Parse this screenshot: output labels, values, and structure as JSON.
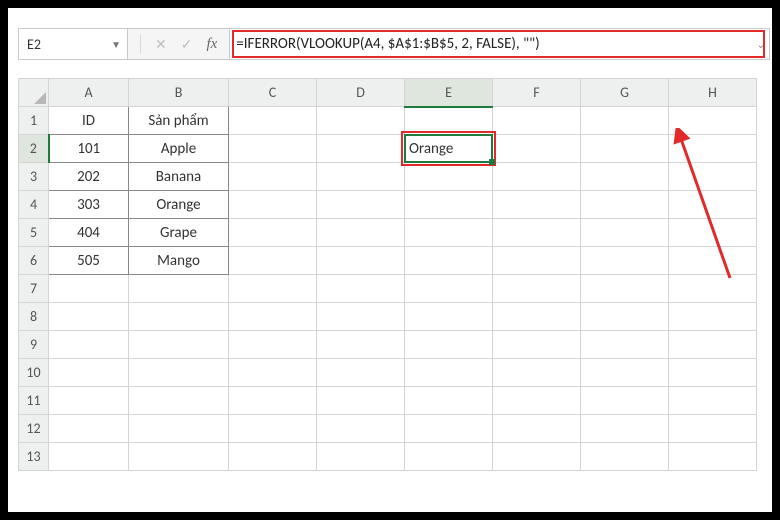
{
  "formula_bar": {
    "cell_reference": "E2",
    "fx_label": "fx",
    "formula": "=IFERROR(VLOOKUP(A4, $A$1:$B$5, 2, FALSE), \"\")",
    "cancel_icon": "✕",
    "enter_icon": "✓"
  },
  "columns": [
    "A",
    "B",
    "C",
    "D",
    "E",
    "F",
    "G",
    "H"
  ],
  "rows": [
    "1",
    "2",
    "3",
    "4",
    "5",
    "6",
    "7",
    "8",
    "9",
    "10",
    "11",
    "12",
    "13"
  ],
  "headers": {
    "A": "ID",
    "B": "Sản phẩm"
  },
  "data": [
    {
      "A": "101",
      "B": "Apple"
    },
    {
      "A": "202",
      "B": "Banana"
    },
    {
      "A": "303",
      "B": "Orange"
    },
    {
      "A": "404",
      "B": "Grape"
    },
    {
      "A": "505",
      "B": "Mango"
    }
  ],
  "active_cell": {
    "ref": "E2",
    "value": "Orange"
  },
  "colors": {
    "highlight": "#e22a2a",
    "selection": "#1f7a3d",
    "header_bg": "#eef0ef"
  }
}
